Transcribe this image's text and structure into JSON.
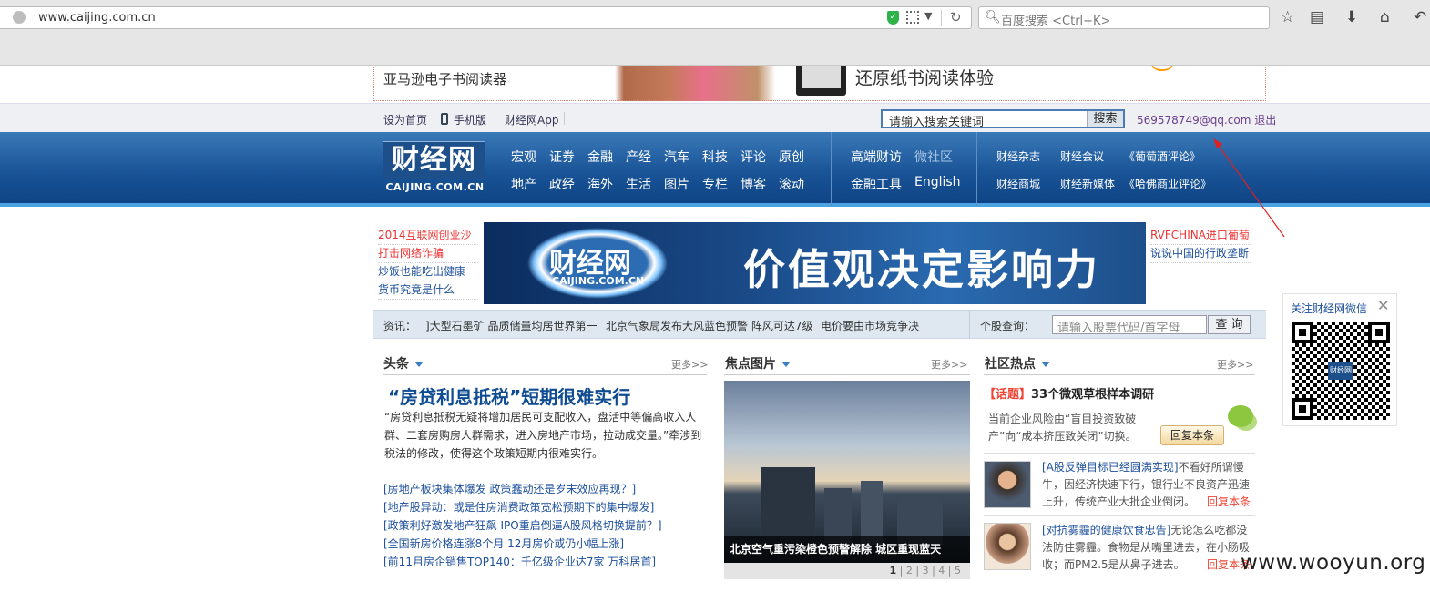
{
  "browser": {
    "url": "www.caijing.com.cn",
    "search_placeholder": "百度搜索 <Ctrl+K>"
  },
  "ad_banner": {
    "left_text": "亚马逊电子书阅读器",
    "right_text": "还原纸书阅读体验"
  },
  "topbar": {
    "links": [
      "设为首页",
      "手机版",
      "财经网App"
    ],
    "search_placeholder": "请输入搜索关键词",
    "search_button": "搜索",
    "user_email": "569578749@qq.com",
    "logout": "退出"
  },
  "nav": {
    "logo_cn": "财经网",
    "logo_en": "CAIJING.COM.CN",
    "row1": [
      "宏观",
      "证券",
      "金融",
      "产经",
      "汽车",
      "科技",
      "评论",
      "原创"
    ],
    "row2": [
      "地产",
      "政经",
      "海外",
      "生活",
      "图片",
      "专栏",
      "博客",
      "滚动"
    ],
    "mid_row1": [
      "高端财访",
      "微社区"
    ],
    "mid_row2": [
      "金融工具",
      "English"
    ],
    "right_row1": [
      "财经杂志",
      "财经会议",
      "《葡萄酒评论》"
    ],
    "right_row2": [
      "财经商城",
      "财经新媒体",
      "《哈佛商业评论》"
    ]
  },
  "promo": {
    "left_links": [
      "2014互联网创业沙",
      "打击网络诈骗",
      "炒饭也能吃出健康",
      "货币究竟是什么"
    ],
    "banner_logo_cn": "财经网",
    "banner_logo_en": "CAIJING.COM.CN",
    "banner_slogan": "价值观决定影响力",
    "right_links": [
      "RVFCHINA进口葡萄",
      "说说中国的行政垄断"
    ]
  },
  "ticker": {
    "label": "资讯：",
    "items": [
      "]大型石墨矿 品质储量均居世界第一",
      "北京气象局发布大风蓝色预警 阵风可达7级",
      "电价要由市场竞争决"
    ],
    "stock_label": "个股查询：",
    "stock_placeholder": "请输入股票代码/首字母",
    "stock_button": "查 询"
  },
  "headlines": {
    "title": "头条",
    "more": "更多>>",
    "headline": "“房贷利息抵税”短期很难实行",
    "summary": "“房贷利息抵税无疑将增加居民可支配收入，盘活中等偏高收入人群、二套房购房人群需求，进入房地产市场，拉动成交量。”牵涉到税法的修改，使得这个政策短期内很难实行。",
    "links": [
      "[房地产板块集体爆发 政策蠢动还是岁末效应再现？]",
      "[地产股异动：或是住房消费政策宽松预期下的集中爆发]",
      "[政策利好激发地产狂飙 IPO重启倒逼A股风格切换提前？]",
      "[全国新房价格连涨8个月 12月房价或仍小幅上涨]",
      "[前11月房企销售TOP140：千亿级企业达7家 万科居首]"
    ]
  },
  "photos": {
    "title": "焦点图片",
    "more": "更多>>",
    "caption": "北京空气重污染橙色预警解除 城区重现蓝天",
    "pager": [
      "1",
      "2",
      "3",
      "4",
      "5"
    ]
  },
  "community": {
    "title": "社区热点",
    "more": "更多>>",
    "topic_tag": "【话题】",
    "topic_title": "33个微观草根样本调研",
    "topic_summary": "当前企业风险由“盲目投资致破产”向“成本挤压致关闭”切换。",
    "reply_button": "回复本条",
    "posts": [
      {
        "title": "[A股反弹目标已经圆满实现]",
        "text": "不看好所谓慢牛，因经济快速下行，银行业不良资产迅速上升，传统产业大批企业倒闭。",
        "reply": "回复本条"
      },
      {
        "title": "[对抗雾霾的健康饮食忠告]",
        "text": "无论怎么吃都没法防住雾霾。食物是从嘴里进去，在小肠吸收；而PM2.5是从鼻子进去。",
        "reply": "回复本条"
      }
    ]
  },
  "wechat": {
    "title": "关注财经网微信",
    "close": "✕",
    "qr_label": "财经网"
  },
  "watermark": "www.wooyun.org"
}
